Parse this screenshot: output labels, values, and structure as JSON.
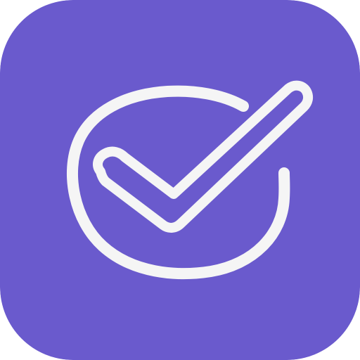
{
  "app_icon": {
    "icon": "hand-drawn-check-in-circle-icon",
    "colors": {
      "background": "#6a5acd",
      "stroke": "#f5f5f5"
    }
  }
}
